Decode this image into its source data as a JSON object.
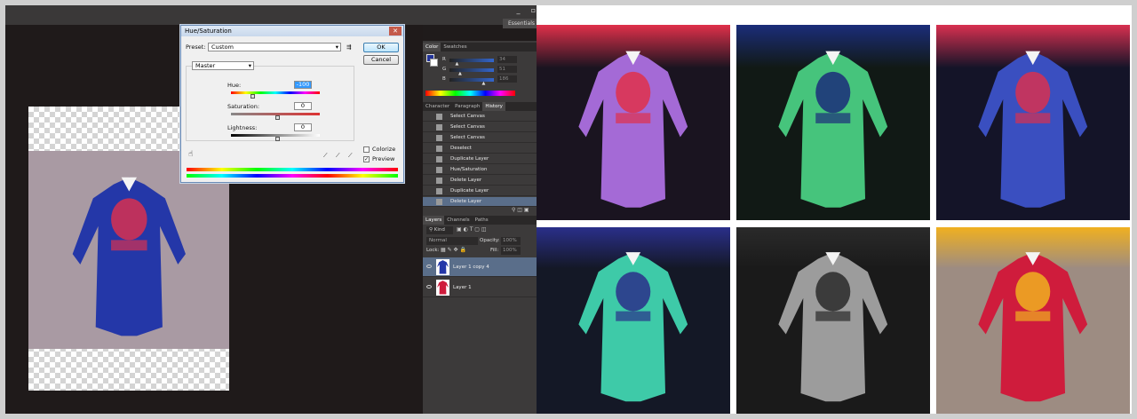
{
  "app": {
    "workspace": "Essentials",
    "window_controls": [
      "_",
      "▫",
      "✕"
    ]
  },
  "dialog": {
    "title": "Hue/Saturation",
    "preset_label": "Preset:",
    "preset_value": "Custom",
    "ok": "OK",
    "cancel": "Cancel",
    "channel": "Master",
    "hue_label": "Hue:",
    "hue_value": "-100",
    "sat_label": "Saturation:",
    "sat_value": "0",
    "light_label": "Lightness:",
    "light_value": "0",
    "colorize": "Colorize",
    "preview": "Preview",
    "hue_level": 0.2222,
    "sat_level": 0.5,
    "light_level": 0.5
  },
  "color_panel": {
    "tabs": [
      "Color",
      "Swatches"
    ],
    "active": "Color",
    "channels": [
      {
        "label": "R",
        "value": "34",
        "fill": 0.13
      },
      {
        "label": "G",
        "value": "51",
        "fill": 0.2
      },
      {
        "label": "B",
        "value": "186",
        "fill": 0.73
      }
    ],
    "fg_color": "#223399"
  },
  "history_panel": {
    "tabs": [
      "Character",
      "Paragraph",
      "History"
    ],
    "active": "History",
    "items": [
      "Select Canvas",
      "Select Canvas",
      "Select Canvas",
      "Deselect",
      "Duplicate Layer",
      "Hue/Saturation",
      "Delete Layer",
      "Duplicate Layer",
      "Delete Layer"
    ]
  },
  "layers_panel": {
    "tabs": [
      "Layers",
      "Channels",
      "Paths"
    ],
    "active": "Layers",
    "filter": "Kind",
    "blend": "Normal",
    "opacity_label": "Opacity:",
    "opacity": "100%",
    "lock_label": "Lock:",
    "fill_label": "Fill:",
    "fill": "100%",
    "layers": [
      {
        "name": "Layer 1 copy 4",
        "selected": true
      },
      {
        "name": "Layer 1",
        "selected": false
      }
    ]
  },
  "variants": [
    {
      "name": "violet",
      "bg": "#1a1420",
      "robe": "#a46ad6",
      "accent": "#e0304a"
    },
    {
      "name": "green",
      "bg": "#111915",
      "robe": "#46c47c",
      "accent": "#1b2d7a"
    },
    {
      "name": "blue",
      "bg": "#141428",
      "robe": "#3a4fc0",
      "accent": "#d83050"
    },
    {
      "name": "teal",
      "bg": "#141826",
      "robe": "#3ecaa8",
      "accent": "#2a2f8a"
    },
    {
      "name": "gray",
      "bg": "#1a1a1a",
      "robe": "#9c9c9c",
      "accent": "#2a2a2a"
    },
    {
      "name": "red",
      "bg": "#9d8c82",
      "robe": "#cf1c3c",
      "accent": "#f0b020"
    }
  ],
  "source_photo": {
    "bg": "#a99aa3",
    "robe": "#2437a8",
    "accent": "#d83050"
  }
}
